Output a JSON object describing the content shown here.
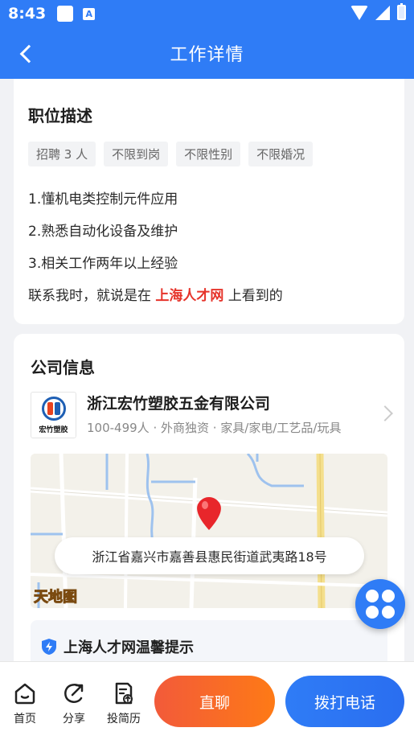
{
  "status_bar": {
    "time": "8:43",
    "notification_letter": "A"
  },
  "header": {
    "title": "工作详情"
  },
  "job": {
    "section_title": "职位描述",
    "tags": [
      "招聘 3 人",
      "不限到岗",
      "不限性别",
      "不限婚况"
    ],
    "requirements": [
      "1.懂机电类控制元件应用",
      "2.熟悉自动化设备及维护",
      "3.相关工作两年以上经验"
    ],
    "contact_prefix": "联系我时，就说是在 ",
    "contact_site": "上海人才网",
    "contact_suffix": " 上看到的"
  },
  "company": {
    "section_title": "公司信息",
    "logo_text": "宏竹塑胶",
    "name": "浙江宏竹塑胶五金有限公司",
    "meta": "100-499人 · 外商独资 · 家具/家电/工艺品/玩具"
  },
  "map": {
    "address": "浙江省嘉兴市嘉善县惠民街道武夷路18号",
    "watermark": "天地图"
  },
  "tip": {
    "title": "上海人才网温馨提示"
  },
  "bottom_nav": {
    "home": "首页",
    "share": "分享",
    "resume": "投简历",
    "chat": "直聊",
    "call": "拨打电话"
  },
  "colors": {
    "brand_blue": "#2f7cf6",
    "highlight_red": "#e6332a",
    "chat_orange": "#fe7a16",
    "map_pin_red": "#e8262b"
  }
}
